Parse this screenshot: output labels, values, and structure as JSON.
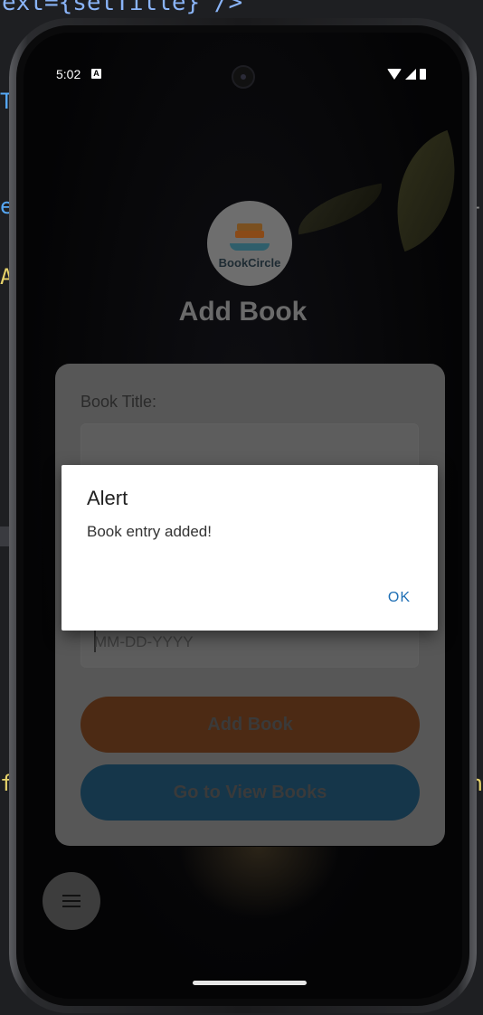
{
  "editor": {
    "code_top": "ext={setTitle} />",
    "gutter_left": [
      "T",
      "e",
      "A",
      "f"
    ],
    "gutter_right": [
      "-",
      "n"
    ]
  },
  "status_bar": {
    "time": "5:02",
    "notification_icon": "A"
  },
  "app": {
    "logo_text": "BookCircle",
    "page_title": "Add Book",
    "form": {
      "title_label": "Book Title:",
      "date_placeholder": "MM-DD-YYYY"
    },
    "buttons": {
      "add_book": "Add Book",
      "view_books": "Go to View Books"
    }
  },
  "dialog": {
    "title": "Alert",
    "message": "Book entry added!",
    "ok_label": "OK"
  },
  "colors": {
    "dialog_ok": "#1e6fb5",
    "add_button": "#4c2a14",
    "view_button": "#15364a"
  }
}
